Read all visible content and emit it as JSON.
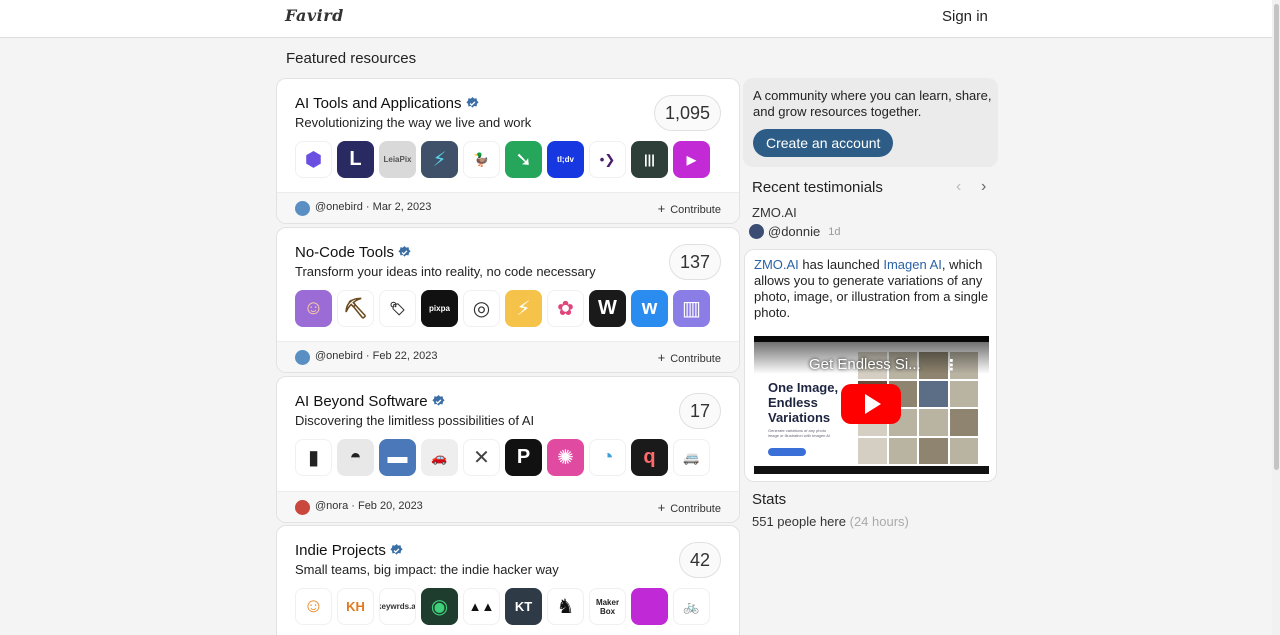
{
  "header": {
    "logo": "Favird",
    "signin_label": "Sign in"
  },
  "featured_title": "Featured resources",
  "cards": [
    {
      "title": "AI Tools and Applications",
      "description": "Revolutionizing the way we live and work",
      "count": "1,095",
      "user": "@onebird",
      "date": "Mar 2, 2023",
      "contribute_label": "Contribute",
      "icons": [
        {
          "name": "hexagon-bolt-icon",
          "bg": "#ffffff",
          "fg": "#6b4fe0",
          "glyph": "⬢"
        },
        {
          "name": "letter-l-icon",
          "bg": "#2a2a63",
          "fg": "#ffffff",
          "glyph": "L"
        },
        {
          "name": "leiapix-converter-icon",
          "bg": "#d9d9d9",
          "fg": "#555555",
          "glyph": "LeiaPix"
        },
        {
          "name": "lightning-circle-icon",
          "bg": "#3f5168",
          "fg": "#5ad0e8",
          "glyph": "⚡"
        },
        {
          "name": "duck-icon",
          "bg": "#ffffff",
          "fg": "#f2b51e",
          "glyph": "🦆"
        },
        {
          "name": "green-arrow-icon",
          "bg": "#26a65b",
          "fg": "#ffffff",
          "glyph": "➘"
        },
        {
          "name": "tldv-icon",
          "bg": "#1737e0",
          "fg": "#ffffff",
          "glyph": "tl;dv"
        },
        {
          "name": "purple-chevron-icon",
          "bg": "#ffffff",
          "fg": "#4a1e6e",
          "glyph": "•❯"
        },
        {
          "name": "bars-circle-icon",
          "bg": "#2d3f38",
          "fg": "#ffffff",
          "glyph": "|||"
        },
        {
          "name": "video-play-gradient-icon",
          "bg": "#c22ad6",
          "fg": "#ffffff",
          "glyph": "▸"
        }
      ]
    },
    {
      "title": "No-Code Tools",
      "description": "Transform your ideas into reality, no code necessary",
      "count": "137",
      "user": "@onebird",
      "date": "Feb 22, 2023",
      "contribute_label": "Contribute",
      "icons": [
        {
          "name": "purple-face-icon",
          "bg": "#9b6cd6",
          "fg": "#ffd2a6",
          "glyph": "☺"
        },
        {
          "name": "pickaxe-icon",
          "bg": "#ffffff",
          "fg": "#6a4a1e",
          "glyph": "⛏"
        },
        {
          "name": "price-tag-icon",
          "bg": "#ffffff",
          "fg": "#333333",
          "glyph": "🏷"
        },
        {
          "name": "pixpa-icon",
          "bg": "#111111",
          "fg": "#ffffff",
          "glyph": "pixpa"
        },
        {
          "name": "circle-grid-icon",
          "bg": "#ffffff",
          "fg": "#333333",
          "glyph": "◎"
        },
        {
          "name": "yellow-bolt-icon",
          "bg": "#f6c34a",
          "fg": "#ffffff",
          "glyph": "⚡"
        },
        {
          "name": "butterfly-icon",
          "bg": "#ffffff",
          "fg": "#e0457b",
          "glyph": "✿"
        },
        {
          "name": "w-black-icon",
          "bg": "#1a1a1a",
          "fg": "#ffffff",
          "glyph": "W"
        },
        {
          "name": "w-blue-icon",
          "bg": "#2b8cf0",
          "fg": "#ffffff",
          "glyph": "w"
        },
        {
          "name": "app-screens-icon",
          "bg": "#8a7ee6",
          "fg": "#ffffff",
          "glyph": "▥"
        }
      ]
    },
    {
      "title": "AI Beyond Software",
      "description": "Discovering the limitless possibilities of AI",
      "count": "17",
      "user": "@nora",
      "date": "Feb 20, 2023",
      "contribute_label": "Contribute",
      "icons": [
        {
          "name": "gimbal-icon",
          "bg": "#ffffff",
          "fg": "#222222",
          "glyph": "▮"
        },
        {
          "name": "security-camera-icon",
          "bg": "#e8e8e8",
          "fg": "#222222",
          "glyph": "◓"
        },
        {
          "name": "truck-icon",
          "bg": "#4a78b8",
          "fg": "#ffffff",
          "glyph": "▬"
        },
        {
          "name": "car-icon",
          "bg": "#eeeeee",
          "fg": "#666666",
          "glyph": "🚗"
        },
        {
          "name": "drone-icon",
          "bg": "#ffffff",
          "fg": "#444444",
          "glyph": "✕"
        },
        {
          "name": "p-logo-icon",
          "bg": "#111111",
          "fg": "#ffffff",
          "glyph": "P"
        },
        {
          "name": "pink-pattern-icon",
          "bg": "#e04aa0",
          "fg": "#ffffff",
          "glyph": "✺"
        },
        {
          "name": "rainbow-circle-icon",
          "bg": "#ffffff",
          "fg": "#3ca0d8",
          "glyph": "◔"
        },
        {
          "name": "q-logo-icon",
          "bg": "#1a1a1a",
          "fg": "#ff6a6a",
          "glyph": "q"
        },
        {
          "name": "delivery-robot-icon",
          "bg": "#ffffff",
          "fg": "#444444",
          "glyph": "🚐"
        }
      ]
    },
    {
      "title": "Indie Projects",
      "description": "Small teams, big impact: the indie hacker way",
      "count": "42",
      "icons": [
        {
          "name": "orange-face-icon",
          "bg": "#ffffff",
          "fg": "#e88b2c",
          "glyph": "☺"
        },
        {
          "name": "kh-logo-icon",
          "bg": "#ffffff",
          "fg": "#e07a1e",
          "glyph": "KH"
        },
        {
          "name": "keywrds-ai-icon",
          "bg": "#ffffff",
          "fg": "#333333",
          "glyph": "keywrds.ai"
        },
        {
          "name": "green-ring-icon",
          "bg": "#1e3d2e",
          "fg": "#3fd07a",
          "glyph": "◉"
        },
        {
          "name": "mountains-icon",
          "bg": "#ffffff",
          "fg": "#111111",
          "glyph": "▲▲"
        },
        {
          "name": "kt-logo-icon",
          "bg": "#2e3a46",
          "fg": "#ffffff",
          "glyph": "KT"
        },
        {
          "name": "chess-knight-icon",
          "bg": "#ffffff",
          "fg": "#111111",
          "glyph": "♞"
        },
        {
          "name": "makerbox-icon",
          "bg": "#ffffff",
          "fg": "#222222",
          "glyph": "Maker Box"
        },
        {
          "name": "purple-blob-icon",
          "bg": "#c02ad6",
          "fg": "#ffffff",
          "glyph": ""
        },
        {
          "name": "bird-bicycle-icon",
          "bg": "#ffffff",
          "fg": "#111111",
          "glyph": "🚲"
        }
      ]
    }
  ],
  "sidebar": {
    "intro": "A community where you can learn, share, and grow resources together.",
    "create_label": "Create an account",
    "recent_title": "Recent testimonials",
    "prev_arrow": "‹",
    "next_arrow": "›",
    "company": "ZMO.AI",
    "user": "@donnie",
    "ago": "1d",
    "testimonial": {
      "link1": "ZMO.AI",
      "part1": " has launched ",
      "link2": "Imagen AI",
      "part2": ", which allows you to generate variations of any photo, image, or illustration from a single photo."
    },
    "video": {
      "title": "Get Endless Si...",
      "headline": "One Image,\nEndless\nVariations",
      "sub": "Generate variations of any photo image or illustration with Imagen AI"
    },
    "stats_title": "Stats",
    "stats_count": "551 people here",
    "stats_period": "(24 hours)"
  },
  "colors": {
    "accent": "#2d5d86",
    "link": "#2a63a5",
    "verified": "#3a6ea5"
  }
}
